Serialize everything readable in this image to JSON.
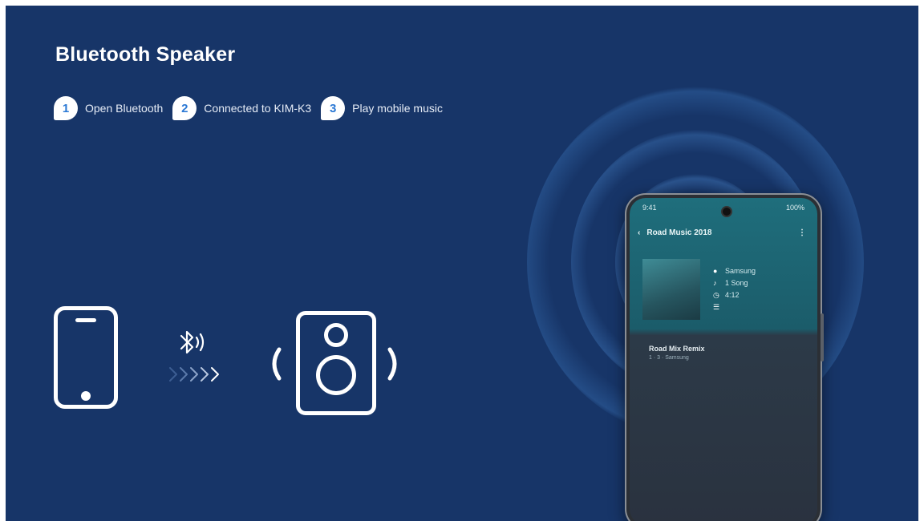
{
  "title": "Bluetooth Speaker",
  "steps": [
    {
      "number": "1",
      "label": "Open Bluetooth"
    },
    {
      "number": "2",
      "label": "Connected to KIM-K3"
    },
    {
      "number": "3",
      "label": "Play mobile music"
    }
  ],
  "colors": {
    "background": "#173568",
    "accent": "#2a78d4",
    "foreground": "#ffffff"
  },
  "icons": {
    "phone": "smartphone-icon",
    "bluetooth": "bluetooth-signal-icon",
    "transfer": "chevrons-right-icon",
    "speaker": "speaker-icon"
  },
  "phone_screen": {
    "status_left": "9:41",
    "status_right": "100%",
    "album_title": "Road Music 2018",
    "meta": [
      {
        "icon": "person-icon",
        "text": "Samsung"
      },
      {
        "icon": "note-icon",
        "text": "1 Song"
      },
      {
        "icon": "clock-icon",
        "text": "4:12"
      },
      {
        "icon": "list-icon",
        "text": ""
      }
    ],
    "track_title": "Road Mix Remix",
    "track_sub": "1 · 3 · Samsung"
  }
}
